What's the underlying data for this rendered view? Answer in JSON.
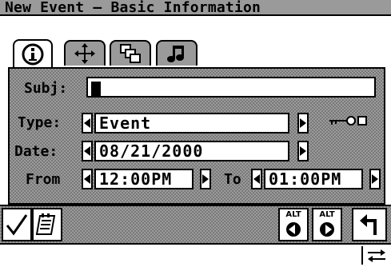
{
  "window": {
    "title": "New Event – Basic Information"
  },
  "tabs": [
    {
      "icon": "info-icon"
    },
    {
      "icon": "move-icon"
    },
    {
      "icon": "linked-pages-icon"
    },
    {
      "icon": "music-note-icon"
    }
  ],
  "form": {
    "subject": {
      "label": "Subj:",
      "value": ""
    },
    "type": {
      "label": "Type:",
      "value": "Event"
    },
    "date": {
      "label": "Date:",
      "value": "08/21/2000"
    },
    "from": {
      "label": "From",
      "value": "12:00PM"
    },
    "to": {
      "label": "To",
      "value": "01:00PM"
    }
  },
  "toolbar": {
    "alt1_label": "ALT",
    "alt2_label": "ALT",
    "buttons": [
      "checkmark-icon",
      "notepad-icon",
      "alt-left-icon",
      "alt-right-icon",
      "return-icon"
    ]
  },
  "statusbar": {
    "icon": "swap-arrows-icon"
  }
}
